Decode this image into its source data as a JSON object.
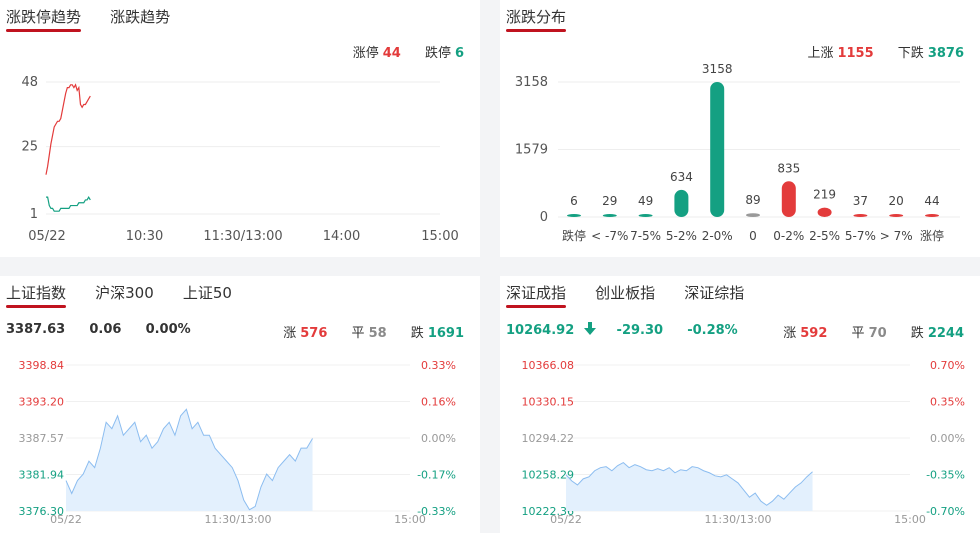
{
  "limit_trend": {
    "tabs": [
      {
        "label": "涨跌停趋势"
      },
      {
        "label": "涨跌趋势"
      }
    ],
    "up_label": "涨停",
    "up_count": "44",
    "down_label": "跌停",
    "down_count": "6",
    "y_ticks": [
      "48",
      "25",
      "1"
    ],
    "x_ticks": [
      "05/22",
      "10:30",
      "11:30/13:00",
      "14:00",
      "15:00"
    ],
    "colors": {
      "up": "#e33b3b",
      "down": "#14a082"
    },
    "chart_data": {
      "type": "line",
      "ylim": [
        1,
        48
      ],
      "x_count": 240,
      "series": [
        {
          "name": "涨停",
          "color": "#e33b3b",
          "x": [
            0,
            3,
            6,
            9,
            12,
            15,
            18,
            21,
            25,
            30,
            35,
            40,
            45,
            50,
            55,
            60,
            65,
            70,
            75,
            80,
            85,
            90,
            95,
            100,
            105,
            110,
            115,
            120
          ],
          "values": [
            15,
            18,
            22,
            26,
            29,
            32,
            33,
            34,
            34,
            35,
            38,
            41,
            44,
            46,
            46,
            47,
            47,
            46,
            47,
            45,
            46,
            40,
            39,
            40,
            40,
            41,
            42,
            43
          ]
        },
        {
          "name": "跌停",
          "color": "#14a082",
          "x": [
            0,
            3,
            6,
            9,
            12,
            15,
            18,
            21,
            25,
            30,
            35,
            40,
            45,
            50,
            55,
            60,
            65,
            70,
            75,
            80,
            85,
            90,
            95,
            100,
            105,
            110,
            115,
            120
          ],
          "values": [
            7,
            7,
            4,
            3,
            3,
            2,
            2,
            2,
            2,
            3,
            3,
            3,
            3,
            3,
            3,
            4,
            4,
            4,
            4,
            4,
            5,
            5,
            5,
            5,
            6,
            6,
            7,
            6
          ]
        }
      ]
    }
  },
  "distribution": {
    "tabs": [
      {
        "label": "涨跌分布"
      }
    ],
    "up_label": "上涨",
    "up_count": "1155",
    "down_label": "下跌",
    "down_count": "3876",
    "y_ticks": [
      "3158",
      "1579",
      "0"
    ],
    "chart_data": {
      "type": "bar",
      "ylim": [
        0,
        3158
      ],
      "categories": [
        "跌停",
        "< -7%",
        "7-5%",
        "5-2%",
        "2-0%",
        "0",
        "0-2%",
        "2-5%",
        "5-7%",
        "> 7%",
        "涨停"
      ],
      "values": [
        6,
        29,
        49,
        634,
        3158,
        89,
        835,
        219,
        37,
        20,
        44
      ],
      "colors": [
        "#14a082",
        "#14a082",
        "#14a082",
        "#14a082",
        "#14a082",
        "#9a9a9a",
        "#e33b3b",
        "#e33b3b",
        "#e33b3b",
        "#e33b3b",
        "#e33b3b"
      ]
    }
  },
  "sh_index": {
    "tabs": [
      {
        "label": "上证指数"
      },
      {
        "label": "沪深300"
      },
      {
        "label": "上证50"
      }
    ],
    "price": "3387.63",
    "change": "0.06",
    "pct": "0.00%",
    "up_label": "涨",
    "up": "576",
    "flat_label": "平",
    "flat": "58",
    "down_label": "跌",
    "down": "1691",
    "y_ticks": [
      "3398.84",
      "3393.20",
      "3387.57",
      "3381.94",
      "3376.30"
    ],
    "pct_ticks": [
      "0.33%",
      "0.16%",
      "0.00%",
      "-0.17%",
      "-0.33%"
    ],
    "x_ticks": [
      "05/22",
      "11:30/13:00",
      "15:00"
    ],
    "chart_data": {
      "type": "area",
      "ylim": [
        3376.3,
        3398.84
      ],
      "x_count": 240,
      "x": [
        0,
        4,
        8,
        12,
        16,
        20,
        24,
        28,
        32,
        36,
        40,
        44,
        48,
        52,
        56,
        60,
        64,
        68,
        72,
        76,
        80,
        84,
        88,
        92,
        96,
        100,
        104,
        108,
        112,
        116,
        120,
        124,
        128,
        132,
        136,
        140,
        144,
        148,
        152,
        156,
        160,
        164,
        168,
        172
      ],
      "values": [
        3381,
        3379,
        3381,
        3382,
        3384,
        3383,
        3386,
        3390,
        3389,
        3391,
        3388,
        3389,
        3390,
        3387,
        3388,
        3386,
        3387,
        3389,
        3390,
        3388,
        3391,
        3392,
        3389,
        3390,
        3388,
        3388,
        3386,
        3385,
        3384,
        3383,
        3381,
        3378,
        3376.5,
        3377,
        3380,
        3382,
        3381,
        3383,
        3384,
        3385,
        3384,
        3386,
        3386,
        3387.5
      ]
    }
  },
  "sz_index": {
    "tabs": [
      {
        "label": "深证成指"
      },
      {
        "label": "创业板指"
      },
      {
        "label": "深证综指"
      }
    ],
    "price": "10264.92",
    "change": "-29.30",
    "pct": "-0.28%",
    "up_label": "涨",
    "up": "592",
    "flat_label": "平",
    "flat": "70",
    "down_label": "跌",
    "down": "2244",
    "y_ticks": [
      "10366.08",
      "10330.15",
      "10294.22",
      "10258.29",
      "10222.36"
    ],
    "pct_ticks": [
      "0.70%",
      "0.35%",
      "0.00%",
      "-0.35%",
      "-0.70%"
    ],
    "x_ticks": [
      "05/22",
      "11:30/13:00",
      "15:00"
    ],
    "chart_data": {
      "type": "area",
      "ylim": [
        10222.36,
        10366.08
      ],
      "x_count": 240,
      "x": [
        0,
        4,
        8,
        12,
        16,
        20,
        24,
        28,
        32,
        36,
        40,
        44,
        48,
        52,
        56,
        60,
        64,
        68,
        72,
        76,
        80,
        84,
        88,
        92,
        96,
        100,
        104,
        108,
        112,
        116,
        120,
        124,
        128,
        132,
        136,
        140,
        144,
        148,
        152,
        156,
        160,
        164,
        168,
        172
      ],
      "values": [
        10258,
        10252,
        10248,
        10254,
        10256,
        10262,
        10265,
        10266,
        10262,
        10267,
        10270,
        10265,
        10268,
        10266,
        10263,
        10262,
        10264,
        10262,
        10265,
        10260,
        10263,
        10262,
        10266,
        10265,
        10262,
        10260,
        10257,
        10256,
        10258,
        10254,
        10250,
        10243,
        10236,
        10240,
        10232,
        10228,
        10232,
        10238,
        10234,
        10240,
        10246,
        10250,
        10256,
        10261
      ]
    }
  }
}
